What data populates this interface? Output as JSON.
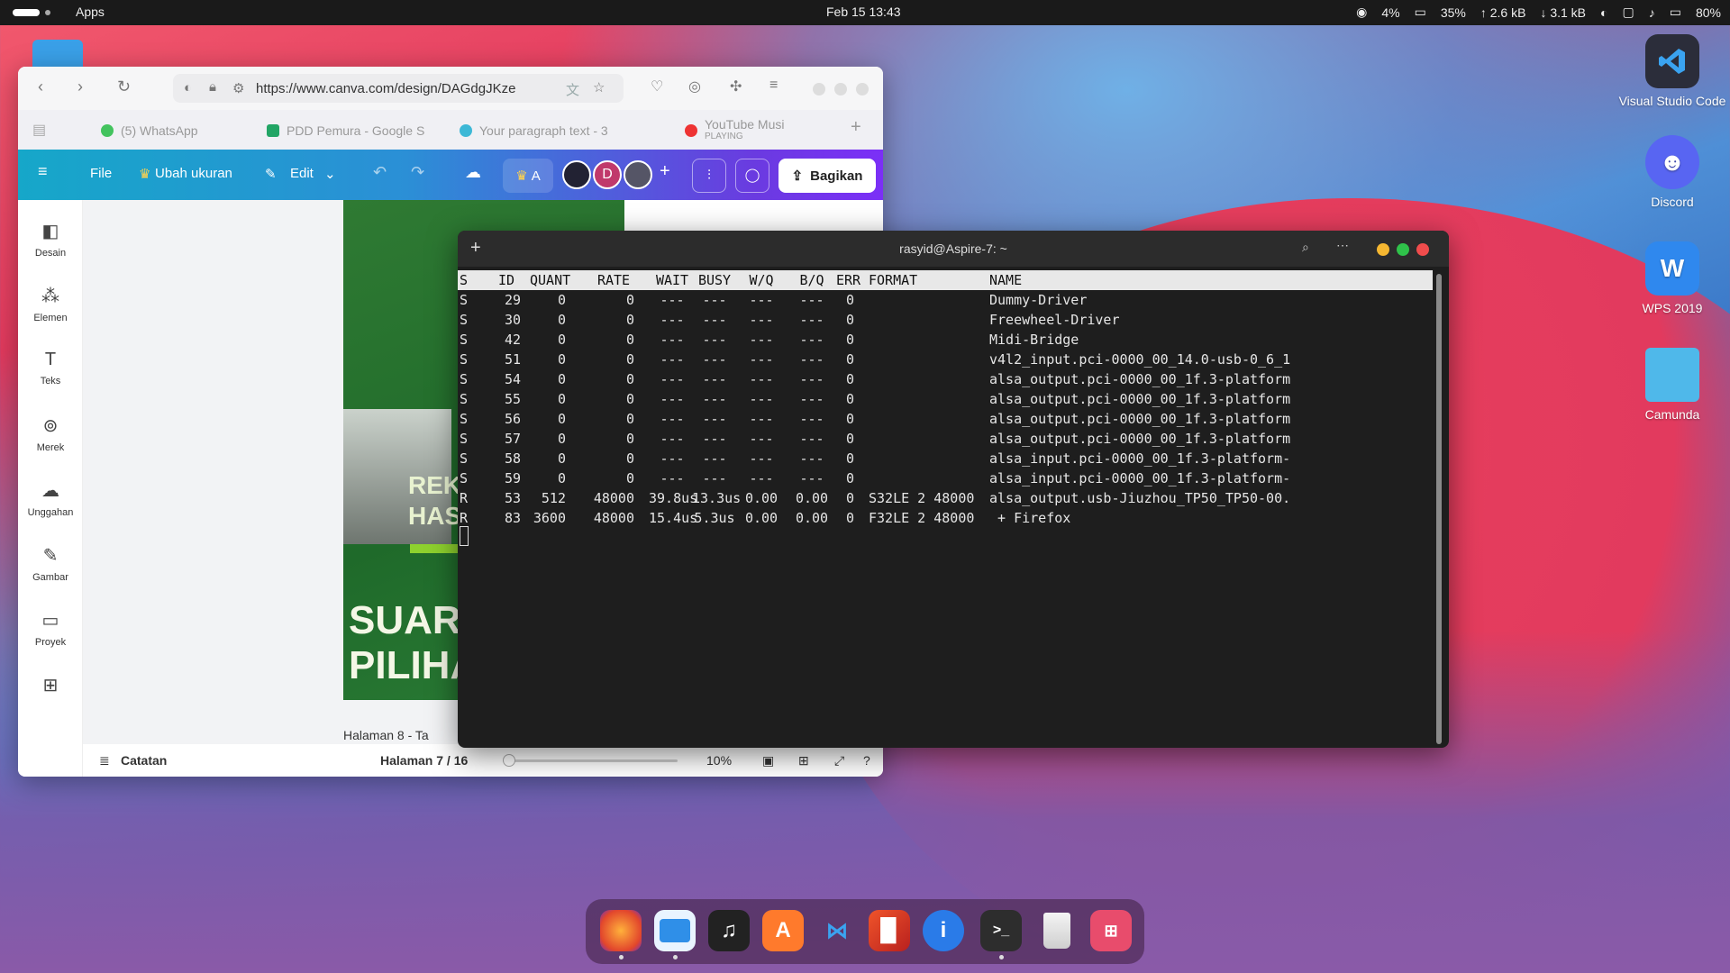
{
  "topbar": {
    "apps": "Apps",
    "clock": "Feb 15  13:43",
    "cpu": "4%",
    "mem": "35%",
    "up": "↑ 2.6 kB",
    "down": "↓ 3.1 kB",
    "battery": "80%"
  },
  "desktop": {
    "icons": [
      {
        "label": "Visual Studio Code"
      },
      {
        "label": "Discord"
      },
      {
        "label": "WPS 2019"
      },
      {
        "label": "Camunda"
      }
    ]
  },
  "browser": {
    "url": "https://www.canva.com/design/DAGdgJKze",
    "tabs": [
      {
        "label": "(5) WhatsApp"
      },
      {
        "label": "PDD Pemura - Google S"
      },
      {
        "label": "Your paragraph text - 3"
      },
      {
        "label": "YouTube Musi",
        "sub": "PLAYING"
      }
    ],
    "toolbar": {
      "file": "File",
      "resize": "Ubah ukuran",
      "edit": "Edit",
      "badge": "A",
      "avatar_d": "D",
      "share": "Bagikan"
    },
    "sidebar": [
      {
        "label": "Desain"
      },
      {
        "label": "Elemen"
      },
      {
        "label": "Teks"
      },
      {
        "label": "Merek"
      },
      {
        "label": "Unggahan"
      },
      {
        "label": "Gambar"
      },
      {
        "label": "Proyek"
      }
    ],
    "canvas": {
      "title_small": "REKA\nHAS",
      "title_big": "SUARAI\nPILIHAN",
      "page_label": "Halaman 8 - Ta"
    },
    "bottom": {
      "notes": "Catatan",
      "page": "Halaman 7 / 16",
      "zoom": "10%",
      "zoom_level": 0.1
    }
  },
  "terminal": {
    "title": "rasyid@Aspire-7: ~",
    "columns": [
      "S",
      "ID",
      "QUANT",
      "RATE",
      "WAIT",
      "BUSY",
      "W/Q",
      "B/Q",
      "ERR",
      "FORMAT",
      "NAME"
    ],
    "rows": [
      [
        "S",
        "29",
        "0",
        "0",
        "---",
        "---",
        "---",
        "---",
        "0",
        "",
        "Dummy-Driver"
      ],
      [
        "S",
        "30",
        "0",
        "0",
        "---",
        "---",
        "---",
        "---",
        "0",
        "",
        "Freewheel-Driver"
      ],
      [
        "S",
        "42",
        "0",
        "0",
        "---",
        "---",
        "---",
        "---",
        "0",
        "",
        "Midi-Bridge"
      ],
      [
        "S",
        "51",
        "0",
        "0",
        "---",
        "---",
        "---",
        "---",
        "0",
        "",
        "v4l2_input.pci-0000_00_14.0-usb-0_6_1"
      ],
      [
        "S",
        "54",
        "0",
        "0",
        "---",
        "---",
        "---",
        "---",
        "0",
        "",
        "alsa_output.pci-0000_00_1f.3-platform"
      ],
      [
        "S",
        "55",
        "0",
        "0",
        "---",
        "---",
        "---",
        "---",
        "0",
        "",
        "alsa_output.pci-0000_00_1f.3-platform"
      ],
      [
        "S",
        "56",
        "0",
        "0",
        "---",
        "---",
        "---",
        "---",
        "0",
        "",
        "alsa_output.pci-0000_00_1f.3-platform"
      ],
      [
        "S",
        "57",
        "0",
        "0",
        "---",
        "---",
        "---",
        "---",
        "0",
        "",
        "alsa_output.pci-0000_00_1f.3-platform"
      ],
      [
        "S",
        "58",
        "0",
        "0",
        "---",
        "---",
        "---",
        "---",
        "0",
        "",
        "alsa_input.pci-0000_00_1f.3-platform-"
      ],
      [
        "S",
        "59",
        "0",
        "0",
        "---",
        "---",
        "---",
        "---",
        "0",
        "",
        "alsa_input.pci-0000_00_1f.3-platform-"
      ],
      [
        "R",
        "53",
        "512",
        "48000",
        "39.8us",
        "13.3us",
        "0.00",
        "0.00",
        "0",
        "S32LE 2 48000",
        "alsa_output.usb-Jiuzhou_TP50_TP50-00."
      ],
      [
        "R",
        "83",
        "3600",
        "48000",
        "15.4us",
        "5.3us",
        "0.00",
        "0.00",
        "0",
        "F32LE 2 48000",
        " + Firefox"
      ]
    ]
  },
  "dock": {
    "apps": [
      "firefox-icon",
      "files-icon",
      "music-icon",
      "appstore-icon",
      "vscode-icon",
      "office-icon",
      "info-icon",
      "terminal-icon",
      "trash-icon",
      "launcher-icon"
    ]
  }
}
